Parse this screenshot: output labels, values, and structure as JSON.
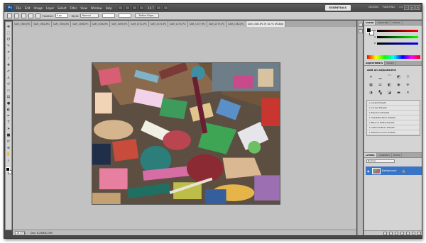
{
  "app": {
    "logo": "Ps",
    "menu": [
      "File",
      "Edit",
      "Image",
      "Layer",
      "Select",
      "Filter",
      "View",
      "Window",
      "Help"
    ],
    "zoom": "24.7",
    "workspace": "ESSENTIALS",
    "workspace_links": [
      "DESIGN",
      "PAINTING",
      ">>"
    ]
  },
  "options_bar": {
    "feather_label": "Feather:",
    "feather_value": "0 px",
    "style_label": "Style:",
    "style_value": "Normal",
    "refine_button": "Refine Edge..."
  },
  "document": {
    "tabs": [
      "SAM_1560.JPG",
      "SAM_1562.JPG",
      "SAM_1564.JPG",
      "SAM_1566.JPG",
      "SAM_1568.JPG",
      "SAM_1569.JPG",
      "SAM_1572.JPG",
      "SAM_1574.JPG",
      "SAM_1575.JPG",
      "SAM_1577.JPG",
      "SAM_1579.JPG",
      "SAM_1583.JPG",
      "SAM_1585.JPG @ 16.7% (RGB/8)"
    ],
    "active_tab_index": 12
  },
  "status_bar": {
    "zoom": "16.67%",
    "doc_info": "Doc: 8.24M/8.24M"
  },
  "panels": {
    "color_tabs": [
      "COLOR",
      "SWATCHES",
      "STYLES"
    ],
    "adjust_tabs": [
      "ADJUSTMENTS",
      "MASKS"
    ],
    "adjust_title": "Add an adjustment",
    "presets": [
      "Levels Presets",
      "Curves Presets",
      "Exposure Presets",
      "Hue/Saturation Presets",
      "Black & White Presets",
      "Channel Mixer Presets",
      "Selective Color Presets"
    ],
    "layers_tabs": [
      "LAYERS",
      "CHANNELS",
      "PATHS"
    ],
    "blend_mode": "Normal",
    "layer_name": "Background"
  },
  "tool_icons": [
    "move-icon",
    "marquee-icon",
    "lasso-icon",
    "quick-select-icon",
    "crop-icon",
    "eyedropper-icon",
    "healing-icon",
    "brush-icon",
    "clone-stamp-icon",
    "history-brush-icon",
    "eraser-icon",
    "gradient-icon",
    "blur-icon",
    "dodge-icon",
    "pen-icon",
    "type-icon",
    "path-select-icon",
    "shape-icon",
    "3d-rotate-icon",
    "3d-orbit-icon",
    "hand-icon",
    "zoom-icon"
  ],
  "adjust_icons": [
    "brightness-icon",
    "levels-icon",
    "curves-icon",
    "exposure-icon",
    "vibrance-icon",
    "hue-sat-icon",
    "color-balance-icon",
    "bw-icon",
    "photo-filter-icon",
    "channel-mixer-icon",
    "invert-icon",
    "posterize-icon",
    "threshold-icon",
    "gradient-map-icon",
    "selective-color-icon"
  ],
  "colors": {
    "chrome": "#484848",
    "options_bar": "#cbcbcb",
    "canvas_bg": "#c2c2c2",
    "layer_selected": "#3a74c6"
  }
}
